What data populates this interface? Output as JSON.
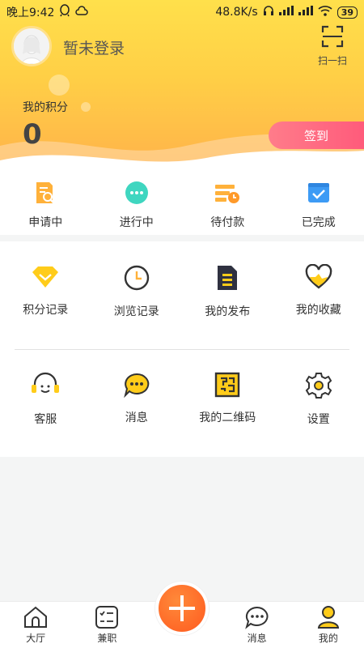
{
  "status": {
    "time": "晚上9:42",
    "speed": "48.8K/s",
    "battery": "39"
  },
  "profile": {
    "login_text": "暂未登录",
    "scan_label": "扫一扫"
  },
  "points": {
    "label": "我的积分",
    "value": "0",
    "checkin_label": "签到"
  },
  "orders": [
    {
      "label": "申请中",
      "icon": "apply-doc-icon"
    },
    {
      "label": "进行中",
      "icon": "in-progress-icon"
    },
    {
      "label": "待付款",
      "icon": "pending-payment-icon"
    },
    {
      "label": "已完成",
      "icon": "completed-icon"
    }
  ],
  "grid": [
    {
      "label": "积分记录",
      "icon": "diamond-icon"
    },
    {
      "label": "浏览记录",
      "icon": "clock-icon"
    },
    {
      "label": "我的发布",
      "icon": "document-icon"
    },
    {
      "label": "我的收藏",
      "icon": "heart-icon"
    },
    {
      "label": "客服",
      "icon": "headset-icon"
    },
    {
      "label": "消息",
      "icon": "chat-bubble-icon"
    },
    {
      "label": "我的二维码",
      "icon": "qrcode-icon"
    },
    {
      "label": "设置",
      "icon": "gear-icon"
    }
  ],
  "nav": [
    {
      "label": "大厅",
      "icon": "home-icon"
    },
    {
      "label": "兼职",
      "icon": "task-list-icon"
    },
    {
      "label": "消息",
      "icon": "message-icon"
    },
    {
      "label": "我的",
      "icon": "user-icon"
    }
  ],
  "colors": {
    "yellow": "#ffd23f",
    "orange": "#ff6a2a",
    "pink": "#ff5b7b",
    "teal": "#3fd6c0",
    "blue": "#3d9bf5"
  }
}
